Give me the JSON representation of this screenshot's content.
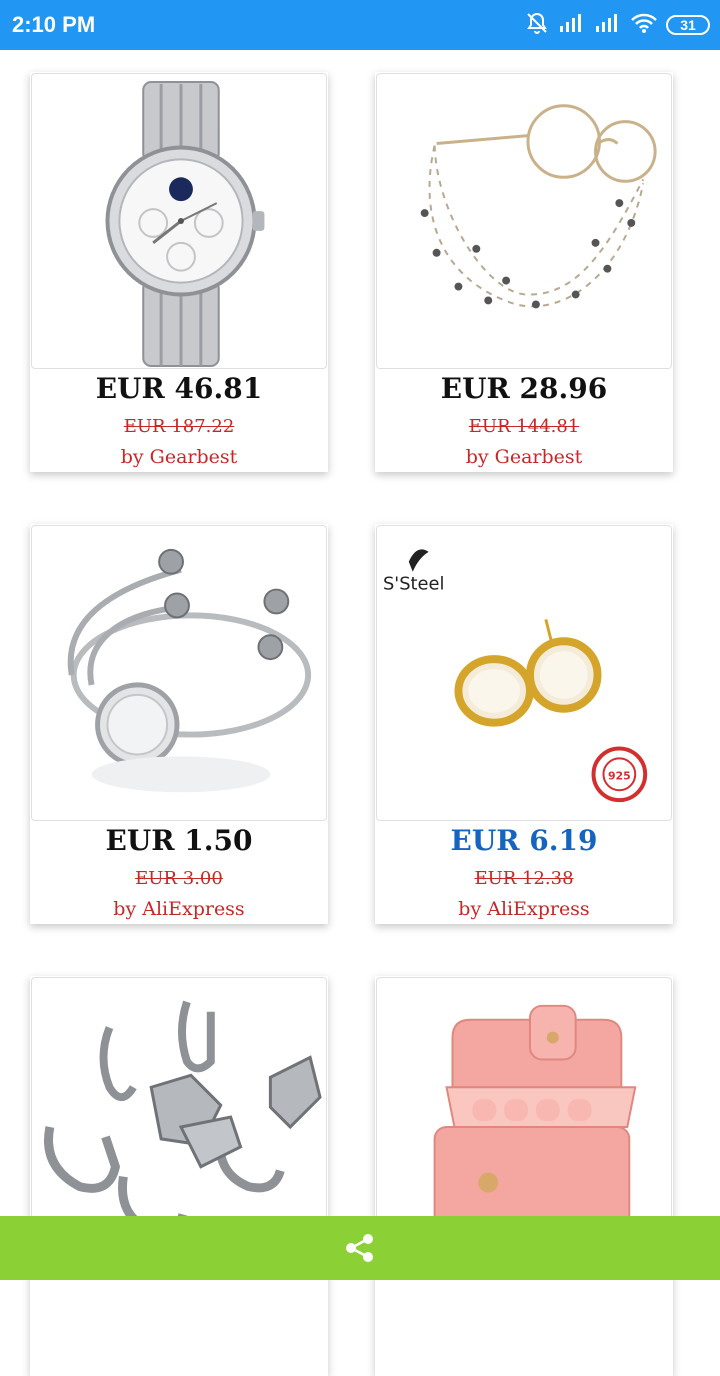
{
  "status_bar": {
    "time": "2:10 PM",
    "battery": "31"
  },
  "products": [
    {
      "price": "EUR 46.81",
      "old_price": "EUR 187.22",
      "seller": "by Gearbest",
      "image": "silver-watch"
    },
    {
      "price": "EUR 28.96",
      "old_price": "EUR 144.81",
      "seller": "by Gearbest",
      "image": "glasses-chain"
    },
    {
      "price": "EUR 1.50",
      "old_price": "EUR 3.00",
      "seller": "by AliExpress",
      "image": "cuff-bracelet"
    },
    {
      "price": "EUR 6.19",
      "old_price": "EUR 12.38",
      "seller": "by AliExpress",
      "image": "pearl-earrings",
      "brand_text": "S'Steel",
      "badge_text": "925"
    },
    {
      "image": "clasp-findings"
    },
    {
      "image": "pink-jewelry-box"
    }
  ],
  "colors": {
    "status_bar": "#2196f3",
    "bottom_bar": "#8bd034",
    "price_highlight": "#1565c0",
    "old_price": "#c62828"
  },
  "bottom_bar": {
    "icon": "share-icon"
  }
}
